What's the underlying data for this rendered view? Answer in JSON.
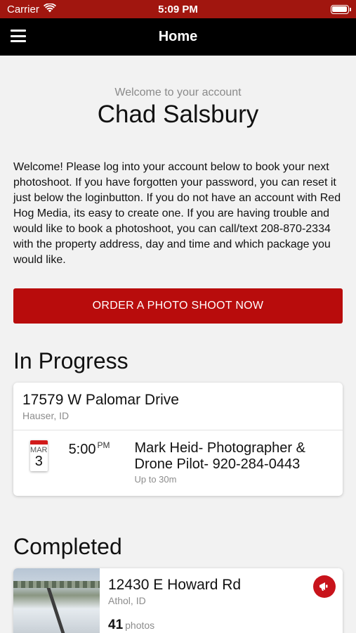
{
  "status_bar": {
    "carrier": "Carrier",
    "time": "5:09 PM"
  },
  "nav": {
    "title": "Home"
  },
  "welcome": {
    "subtitle": "Welcome to your account",
    "name": "Chad Salsbury",
    "message": "Welcome! Please log into your account below to book your next photoshoot. If you have forgotten your password, you can reset it just below the loginbutton. If you do not have an account with Red Hog Media, its easy to create one. If you are having trouble and would like to book a photoshoot, you can call/text 208-870-2334 with the property address, day and time and which package you would like."
  },
  "order_button": {
    "label": "ORDER A PHOTO SHOOT NOW"
  },
  "in_progress": {
    "title": "In Progress",
    "card": {
      "address": "17579 W Palomar Drive",
      "city": "Hauser, ID",
      "month": "MAR",
      "day": "3",
      "time": "5:00",
      "ampm": "PM",
      "provider": "Mark Heid- Photographer & Drone Pilot- 920-284-0443",
      "duration": "Up to 30m"
    }
  },
  "completed": {
    "title": "Completed",
    "card": {
      "address": "12430 E Howard Rd",
      "city": "Athol, ID",
      "photo_count": "41",
      "photo_unit": "photos"
    }
  },
  "colors": {
    "brand_red": "#b80c0c",
    "status_bar": "#a1160f",
    "nav_bar": "#000000"
  },
  "icons": [
    "wifi-icon",
    "battery-icon",
    "menu-icon",
    "calendar-icon",
    "megaphone-icon"
  ]
}
